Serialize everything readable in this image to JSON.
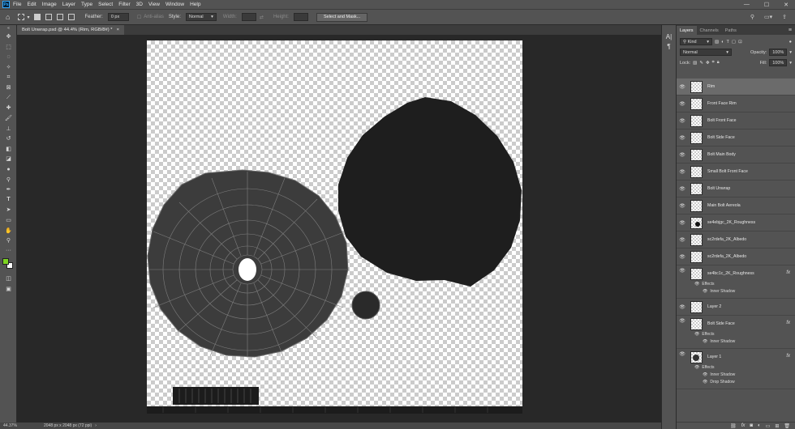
{
  "app": {
    "logo": "Ps"
  },
  "menu": [
    "File",
    "Edit",
    "Image",
    "Layer",
    "Type",
    "Select",
    "Filter",
    "3D",
    "View",
    "Window",
    "Help"
  ],
  "window_controls": {
    "minimize": "—",
    "maximize": "☐",
    "close": "✕"
  },
  "options": {
    "feather_label": "Feather:",
    "feather_value": "0 px",
    "antialias_label": "Anti-alias",
    "style_label": "Style:",
    "style_value": "Normal",
    "width_label": "Width:",
    "height_label": "Height:",
    "select_mask_label": "Select and Mask..."
  },
  "document": {
    "tab_title": "Bolt Unwrap.psd @ 44.4% (Rim, RGB/8#) *",
    "close": "×"
  },
  "status": {
    "zoom": "44.37%",
    "doc_info": "2048 px x 2048 px (72 ppi)"
  },
  "colors": {
    "foreground": "#7dd321",
    "background": "#ffffff",
    "selected_layer": "#6b6b6b",
    "panel": "#535353"
  },
  "panel": {
    "tabs": [
      "Layers",
      "Channels",
      "Paths"
    ],
    "kind_label": "Kind",
    "blend_mode": "Normal",
    "opacity_label": "Opacity:",
    "opacity_value": "100%",
    "lock_label": "Lock:",
    "fill_label": "Fill:",
    "fill_value": "100%"
  },
  "layers": [
    {
      "name": "Rim",
      "selected": true
    },
    {
      "name": "Front Face Rim"
    },
    {
      "name": "Bolt Front Face"
    },
    {
      "name": "Bolt Side Face"
    },
    {
      "name": "Bolt Main Body"
    },
    {
      "name": "Small Bolt Front Face"
    },
    {
      "name": "Bolt Unwrap"
    },
    {
      "name": "Main Bolt Aereola"
    },
    {
      "name": "se4ebjgc_2K_Roughness"
    },
    {
      "name": "sc2rdefa_2K_Albedo"
    },
    {
      "name": "sc2rdefa_2K_Albedo"
    },
    {
      "name": "se4bc1c_2K_Roughness",
      "fx": "fx",
      "effects": [
        "Effects",
        "Inner Shadow"
      ]
    },
    {
      "name": "Layer 2"
    },
    {
      "name": "Bolt Side Face",
      "fx": "fx",
      "effects": [
        "Effects",
        "Inner Shadow"
      ]
    },
    {
      "name": "Layer 1",
      "fx": "fx",
      "effects": [
        "Effects",
        "Inner Shadow",
        "Drop Shadow"
      ]
    }
  ]
}
